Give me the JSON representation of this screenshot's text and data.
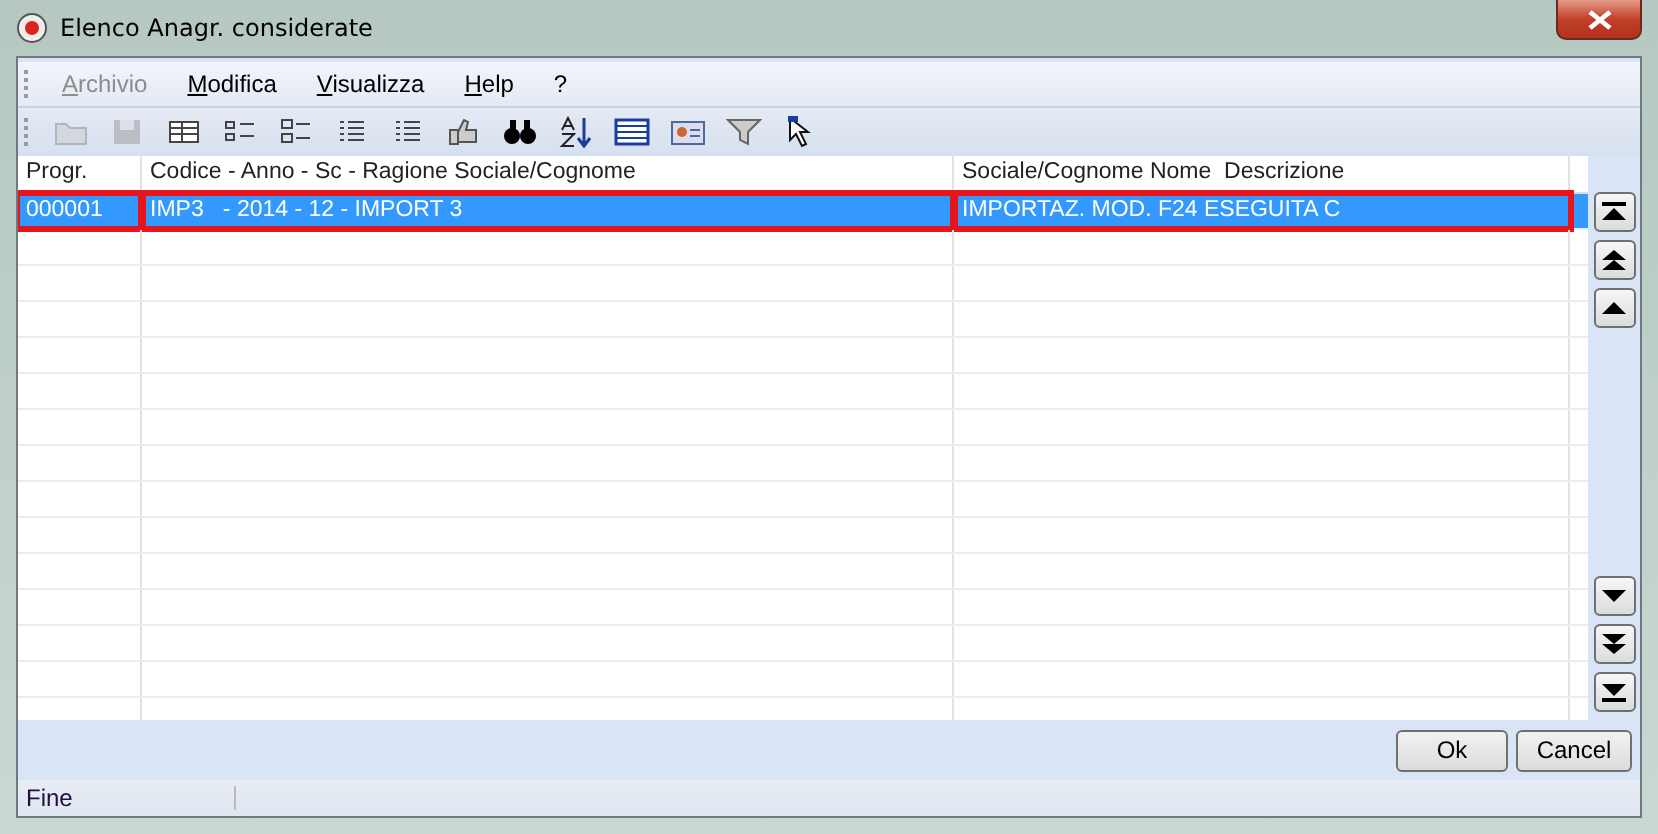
{
  "window": {
    "title": "Elenco Anagr. considerate"
  },
  "menu": [
    {
      "label": "Archivio",
      "disabled": true
    },
    {
      "label": "Modifica",
      "disabled": false
    },
    {
      "label": "Visualizza",
      "disabled": false
    },
    {
      "label": "Help",
      "disabled": false
    },
    {
      "label": "?",
      "disabled": false
    }
  ],
  "toolbar": [
    {
      "kind": "folder",
      "disabled": true
    },
    {
      "kind": "save",
      "disabled": true
    },
    {
      "kind": "grid",
      "disabled": false
    },
    {
      "kind": "checklist",
      "disabled": false
    },
    {
      "kind": "options",
      "disabled": false
    },
    {
      "kind": "list",
      "disabled": false
    },
    {
      "kind": "list",
      "disabled": false
    },
    {
      "kind": "thumb",
      "disabled": false
    },
    {
      "kind": "binoculars",
      "disabled": false
    },
    {
      "kind": "sort",
      "disabled": false
    },
    {
      "kind": "table",
      "disabled": false
    },
    {
      "kind": "card",
      "disabled": false
    },
    {
      "kind": "filter",
      "disabled": false
    },
    {
      "kind": "pointer",
      "disabled": false
    }
  ],
  "table": {
    "columns": [
      "Progr.",
      "Codice - Anno - Sc - Ragione Sociale/Cognome",
      "Sociale/Cognome Nome  Descrizione"
    ],
    "rows": [
      {
        "selected": true,
        "cells": [
          {
            "text": "000001",
            "outlined": true
          },
          {
            "text": "IMP3   - 2014 - 12 - IMPORT 3",
            "outlined": true
          },
          {
            "text": "IMPORTAZ. MOD. F24 ESEGUITA C",
            "outlined": true
          }
        ]
      }
    ]
  },
  "nav_buttons": [
    {
      "kind": "first"
    },
    {
      "kind": "page-up"
    },
    {
      "kind": "up"
    },
    {
      "kind": "down"
    },
    {
      "kind": "page-down"
    },
    {
      "kind": "last"
    }
  ],
  "buttons": [
    "Ok",
    "Cancel"
  ],
  "status_bar": "Fine"
}
